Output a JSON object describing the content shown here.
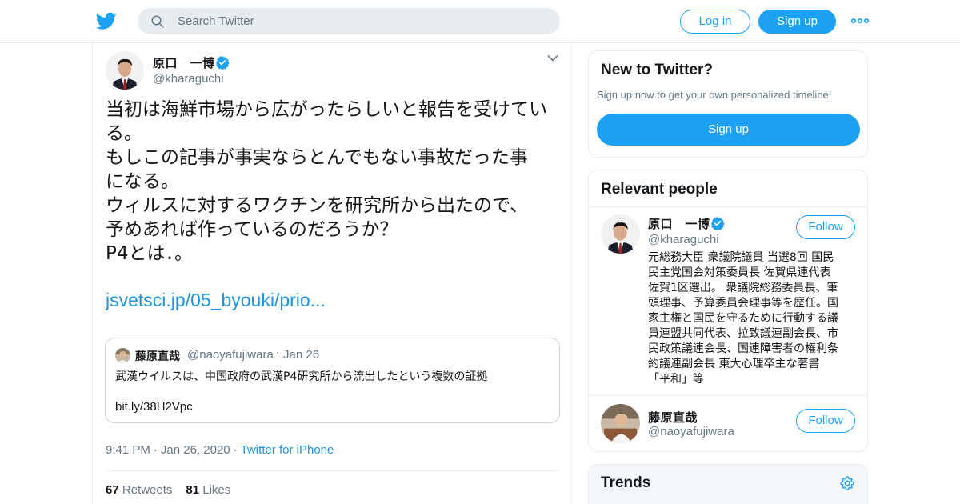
{
  "header": {
    "search_placeholder": "Search Twitter",
    "login_label": "Log in",
    "signup_label": "Sign up"
  },
  "tweet": {
    "author_name": "原口　一博",
    "author_handle": "@kharaguchi",
    "text_lines": [
      "当初は海鮮市場から広がったらしいと報告を受けてい",
      "る。",
      "もしこの記事が事実ならとんでもない事故だった事",
      "になる。",
      "ウィルスに対するワクチンを研究所から出たので、",
      "予めあれば作っているのだろうか？",
      "P4とは．。"
    ],
    "link_text": "jsvetsci.jp/05_byouki/prio...",
    "quote": {
      "name": "藤原直哉",
      "handle": "@naoyafujiwara",
      "date": "Jan 26",
      "text": "武漢ウイルスは、中国政府の武漢P4研究所から流出したという複数の証拠",
      "link": "bit.ly/38H2Vpc"
    },
    "time": "9:41 PM",
    "date": "Jan 26, 2020",
    "source": "Twitter for iPhone",
    "retweets_count": "67",
    "retweets_label": "Retweets",
    "likes_count": "81",
    "likes_label": "Likes"
  },
  "sidebar": {
    "new_title": "New to Twitter?",
    "new_subtitle": "Sign up now to get your own personalized timeline!",
    "new_signup_label": "Sign up",
    "relevant_title": "Relevant people",
    "people": [
      {
        "name": "原口　一博",
        "handle": "@kharaguchi",
        "follow_label": "Follow",
        "bio_lines": [
          "元総務大臣 衆議院議員 当選8回 国民",
          "民主党国会対策委員長 佐賀県連代表",
          "佐賀1区選出。 衆議院総務委員長、筆",
          "頭理事、予算委員会理事等を歴任。国",
          "家主権と国民を守るために行動する議",
          "員連盟共同代表、拉致議連副会長、市",
          "民政策議連会長、国連障害者の権利条",
          "約議連副会長 東大心理卒主な著書",
          "「平和」等"
        ]
      },
      {
        "name": "藤原直哉",
        "handle": "@naoyafujiwara",
        "follow_label": "Follow"
      }
    ],
    "trends_title": "Trends"
  },
  "colors": {
    "brand": "#1da1f2",
    "link": "#1b95e0",
    "secondary_text": "#657786"
  }
}
